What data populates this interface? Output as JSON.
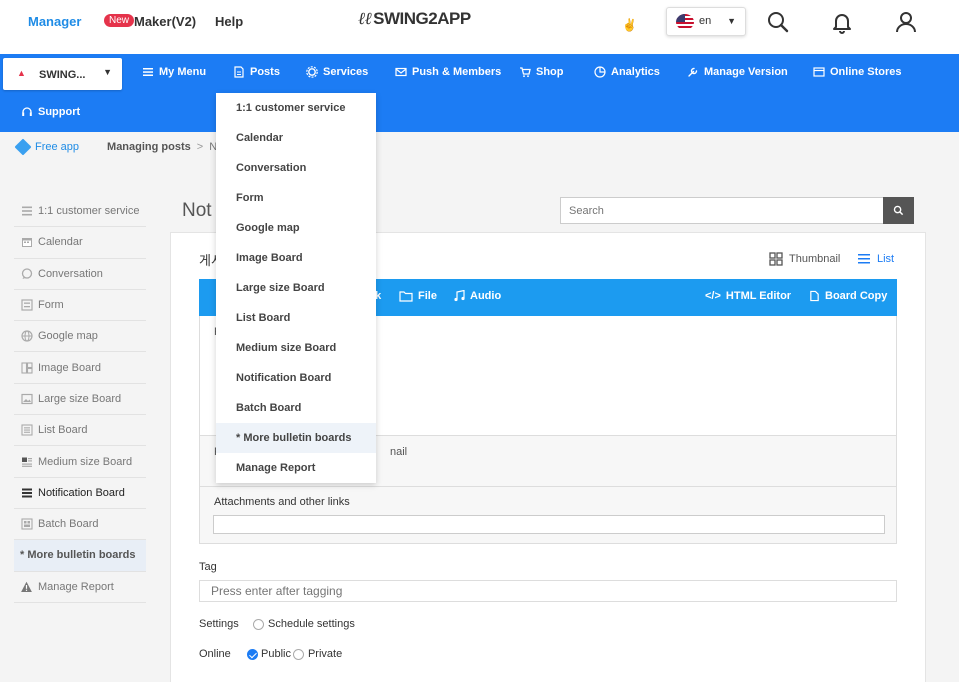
{
  "header": {
    "manager": "Manager",
    "new_badge": "New",
    "maker": "Maker(V2)",
    "help": "Help",
    "logo_text": "SWING2APP",
    "language": "en"
  },
  "nav": {
    "app_name": "SWING...",
    "items": [
      {
        "label": "My Menu",
        "icon": "menu-icon"
      },
      {
        "label": "Posts",
        "icon": "document-icon"
      },
      {
        "label": "Services",
        "icon": "gear-icon"
      },
      {
        "label": "Push & Members",
        "icon": "mail-icon"
      },
      {
        "label": "Shop",
        "icon": "cart-icon"
      },
      {
        "label": "Analytics",
        "icon": "pie-chart-icon"
      },
      {
        "label": "Manage Version",
        "icon": "wrench-icon"
      },
      {
        "label": "Online Stores",
        "icon": "store-icon"
      },
      {
        "label": "Support",
        "icon": "headset-icon"
      }
    ]
  },
  "breadcrumb": {
    "home": "Free app",
    "section": "Managing posts",
    "separator": ">",
    "current": "Noti"
  },
  "sidebar": {
    "items": [
      {
        "label": "1:1 customer service",
        "icon": "list-icon"
      },
      {
        "label": "Calendar",
        "icon": "calendar-icon"
      },
      {
        "label": "Conversation",
        "icon": "chat-icon"
      },
      {
        "label": "Form",
        "icon": "form-icon"
      },
      {
        "label": "Google map",
        "icon": "globe-icon"
      },
      {
        "label": "Image Board",
        "icon": "image-board-icon"
      },
      {
        "label": "Large size Board",
        "icon": "image-icon"
      },
      {
        "label": "List Board",
        "icon": "list-icon"
      },
      {
        "label": "Medium size Board",
        "icon": "medium-board-icon"
      },
      {
        "label": "Notification Board",
        "icon": "notification-board-icon"
      },
      {
        "label": "Batch Board",
        "icon": "batch-icon"
      },
      {
        "label": "* More bulletin boards",
        "icon": ""
      },
      {
        "label": "Manage Report",
        "icon": "warning-icon"
      }
    ]
  },
  "main": {
    "title": "Not",
    "search_placeholder": "Search",
    "board_title": "게시",
    "view_thumbnail": "Thumbnail",
    "view_list": "List",
    "editor": {
      "link_label": "ak",
      "file_label": "File",
      "audio_label": "Audio",
      "html_editor": "HTML Editor",
      "board_copy": "Board Copy",
      "f1": "F"
    },
    "thumb_row_prefix": "F",
    "thumb_row_text": "nail",
    "attachments_label": "Attachments and other links",
    "tag_label": "Tag",
    "tag_placeholder": "Press enter after tagging",
    "settings_label": "Settings",
    "schedule_label": "Schedule settings",
    "online_label": "Online",
    "public_label": "Public",
    "private_label": "Private"
  },
  "dropdown": {
    "items": [
      "1:1 customer service",
      "Calendar",
      "Conversation",
      "Form",
      "Google map",
      "Image Board",
      "Large size Board",
      "List Board",
      "Medium size Board",
      "Notification Board",
      "Batch Board",
      "* More bulletin boards",
      "Manage Report"
    ]
  },
  "colors": {
    "nav_blue": "#1c7cf4",
    "editor_blue": "#1c9bf0",
    "brand_red": "#e5334b",
    "link_blue": "#1f8ce6"
  }
}
